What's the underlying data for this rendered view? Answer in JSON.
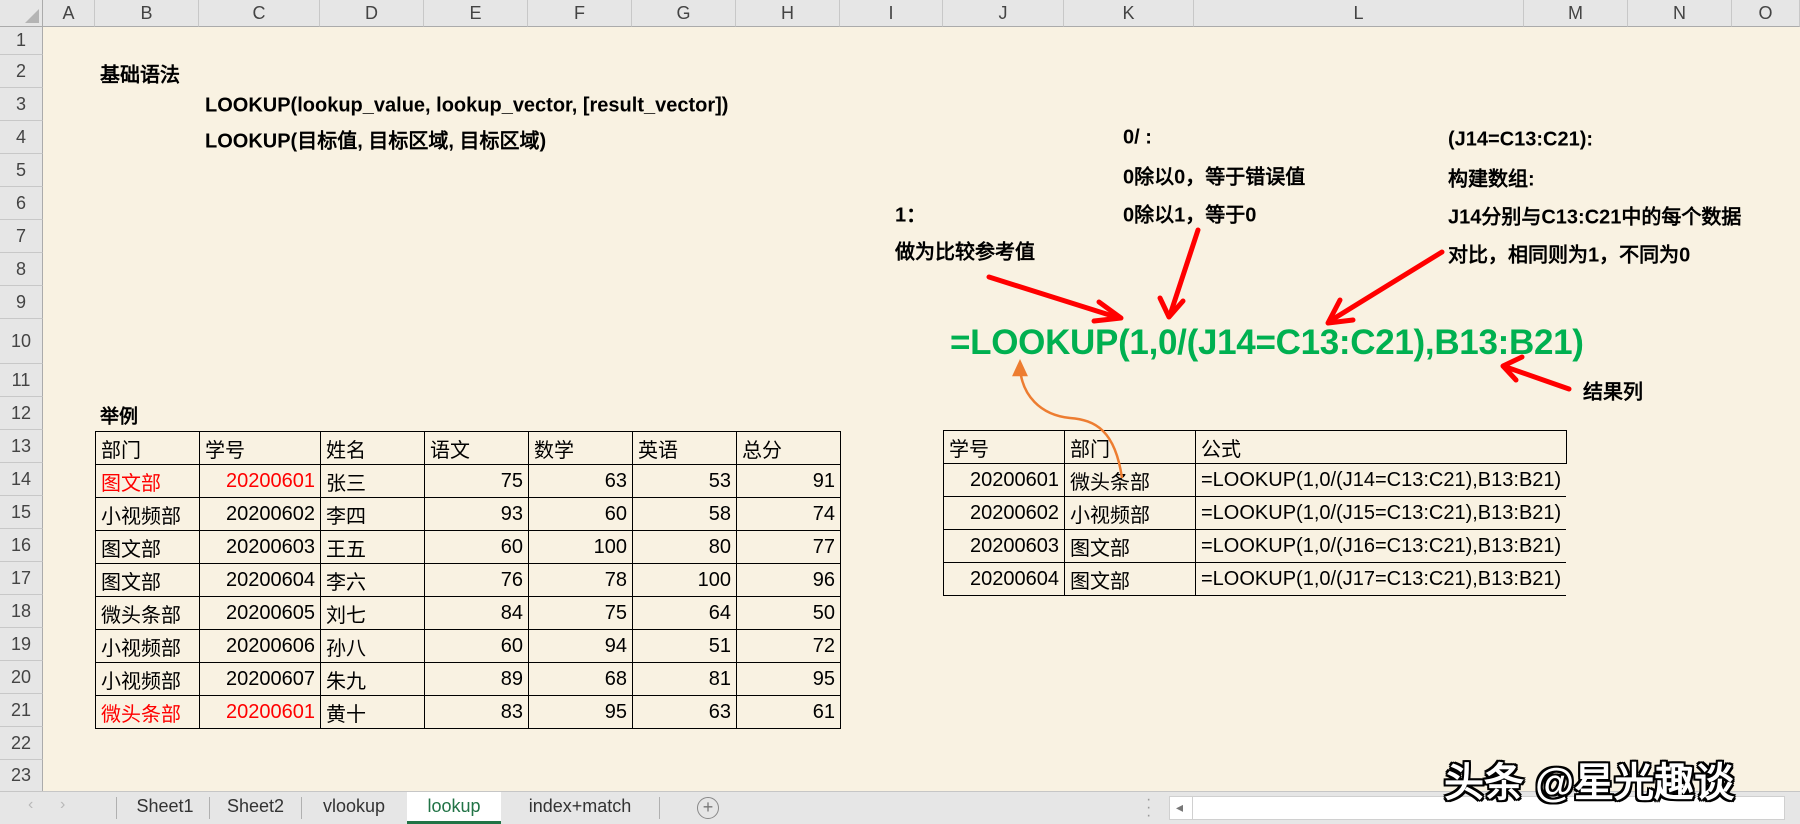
{
  "columns": [
    "A",
    "B",
    "C",
    "D",
    "E",
    "F",
    "G",
    "H",
    "I",
    "J",
    "K",
    "L",
    "M",
    "N",
    "O"
  ],
  "rows": [
    "1",
    "2",
    "3",
    "4",
    "5",
    "6",
    "7",
    "8",
    "9",
    "10",
    "11",
    "12",
    "13",
    "14",
    "15",
    "16",
    "17",
    "18",
    "19",
    "20",
    "21",
    "22",
    "23"
  ],
  "syntax": {
    "title": "基础语法",
    "line1": "LOOKUP(lookup_value, lookup_vector, [result_vector])",
    "line2": "LOOKUP(目标值, 目标区域, 目标区域)"
  },
  "notes": {
    "one_title": "1：",
    "one_desc": "做为比较参考值",
    "zero_title": "0/ :",
    "zero_line1": "0除以0，等于错误值",
    "zero_line2": "0除以1，等于0",
    "array_title": "(J14=C13:C21):",
    "array_line1": "构建数组:",
    "array_line2": "J14分别与C13:C21中的每个数据",
    "array_line3": "对比，相同则为1，不同为0",
    "result_col": "结果列"
  },
  "big_formula": "=LOOKUP(1,0/(J14=C13:C21),B13:B21)",
  "example_label": "举例",
  "table1": {
    "headers": [
      "部门",
      "学号",
      "姓名",
      "语文",
      "数学",
      "英语",
      "总分"
    ],
    "rows": [
      {
        "dept": "图文部",
        "id": "20200601",
        "name": "张三",
        "chinese": "75",
        "math": "63",
        "english": "53",
        "total": "91",
        "highlight": true
      },
      {
        "dept": "小视频部",
        "id": "20200602",
        "name": "李四",
        "chinese": "93",
        "math": "60",
        "english": "58",
        "total": "74",
        "highlight": false
      },
      {
        "dept": "图文部",
        "id": "20200603",
        "name": "王五",
        "chinese": "60",
        "math": "100",
        "english": "80",
        "total": "77",
        "highlight": false
      },
      {
        "dept": "图文部",
        "id": "20200604",
        "name": "李六",
        "chinese": "76",
        "math": "78",
        "english": "100",
        "total": "96",
        "highlight": false
      },
      {
        "dept": "微头条部",
        "id": "20200605",
        "name": "刘七",
        "chinese": "84",
        "math": "75",
        "english": "64",
        "total": "50",
        "highlight": false
      },
      {
        "dept": "小视频部",
        "id": "20200606",
        "name": "孙八",
        "chinese": "60",
        "math": "94",
        "english": "51",
        "total": "72",
        "highlight": false
      },
      {
        "dept": "小视频部",
        "id": "20200607",
        "name": "朱九",
        "chinese": "89",
        "math": "68",
        "english": "81",
        "total": "95",
        "highlight": false
      },
      {
        "dept": "微头条部",
        "id": "20200601",
        "name": "黄十",
        "chinese": "83",
        "math": "95",
        "english": "63",
        "total": "61",
        "highlight": true
      }
    ]
  },
  "table2": {
    "headers": [
      "学号",
      "部门",
      "公式"
    ],
    "rows": [
      {
        "id": "20200601",
        "dept": "微头条部",
        "formula": "=LOOKUP(1,0/(J14=C13:C21),B13:B21)"
      },
      {
        "id": "20200602",
        "dept": "小视频部",
        "formula": "=LOOKUP(1,0/(J15=C13:C21),B13:B21)"
      },
      {
        "id": "20200603",
        "dept": "图文部",
        "formula": "=LOOKUP(1,0/(J16=C13:C21),B13:B21)"
      },
      {
        "id": "20200604",
        "dept": "图文部",
        "formula": "=LOOKUP(1,0/(J17=C13:C21),B13:B21)"
      }
    ]
  },
  "sheet_tabs": [
    {
      "label": "Sheet1",
      "active": false
    },
    {
      "label": "Sheet2",
      "active": false
    },
    {
      "label": "vlookup",
      "active": false
    },
    {
      "label": "lookup",
      "active": true
    },
    {
      "label": "index+match",
      "active": false
    }
  ],
  "add_sheet_icon": "+",
  "watermark": "头条 @星光趣谈",
  "colors": {
    "formula_green": "#00b050",
    "highlight_red": "#ff0000",
    "arrow_red": "#ff0000",
    "arrow_orange": "#ed7d31",
    "sheet_bg": "#f9f2e2",
    "active_tab": "#217346"
  }
}
